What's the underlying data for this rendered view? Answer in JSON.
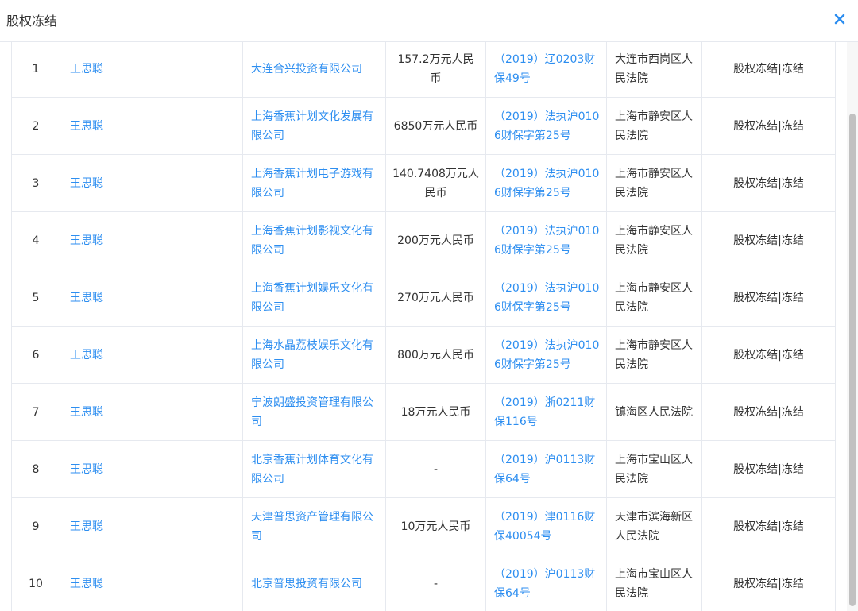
{
  "header": {
    "title": "股权冻结",
    "close_icon": "close-icon"
  },
  "colors": {
    "link": "#2d8ef0",
    "border": "#e6e9ef",
    "text": "#333333"
  },
  "rows": [
    {
      "index": "1",
      "person": "王思聪",
      "company": "大连合兴投资有限公司",
      "amount": "157.2万元人民币",
      "case_no": "（2019）辽0203财保49号",
      "court": "大连市西岗区人民法院",
      "status": "股权冻结|冻结"
    },
    {
      "index": "2",
      "person": "王思聪",
      "company": "上海香蕉计划文化发展有限公司",
      "amount": "6850万元人民币",
      "case_no": "（2019）法执沪0106财保字第25号",
      "court": "上海市静安区人民法院",
      "status": "股权冻结|冻结"
    },
    {
      "index": "3",
      "person": "王思聪",
      "company": "上海香蕉计划电子游戏有限公司",
      "amount": "140.7408万元人民币",
      "case_no": "（2019）法执沪0106财保字第25号",
      "court": "上海市静安区人民法院",
      "status": "股权冻结|冻结"
    },
    {
      "index": "4",
      "person": "王思聪",
      "company": "上海香蕉计划影视文化有限公司",
      "amount": "200万元人民币",
      "case_no": "（2019）法执沪0106财保字第25号",
      "court": "上海市静安区人民法院",
      "status": "股权冻结|冻结"
    },
    {
      "index": "5",
      "person": "王思聪",
      "company": "上海香蕉计划娱乐文化有限公司",
      "amount": "270万元人民币",
      "case_no": "（2019）法执沪0106财保字第25号",
      "court": "上海市静安区人民法院",
      "status": "股权冻结|冻结"
    },
    {
      "index": "6",
      "person": "王思聪",
      "company": "上海水晶荔枝娱乐文化有限公司",
      "amount": "800万元人民币",
      "case_no": "（2019）法执沪0106财保字第25号",
      "court": "上海市静安区人民法院",
      "status": "股权冻结|冻结"
    },
    {
      "index": "7",
      "person": "王思聪",
      "company": "宁波朗盛投资管理有限公司",
      "amount": "18万元人民币",
      "case_no": "（2019）浙0211财保116号",
      "court": "镇海区人民法院",
      "status": "股权冻结|冻结"
    },
    {
      "index": "8",
      "person": "王思聪",
      "company": "北京香蕉计划体育文化有限公司",
      "amount": "-",
      "case_no": "（2019）沪0113财保64号",
      "court": "上海市宝山区人民法院",
      "status": "股权冻结|冻结"
    },
    {
      "index": "9",
      "person": "王思聪",
      "company": "天津普思资产管理有限公司",
      "amount": "10万元人民币",
      "case_no": "（2019）津0116财保40054号",
      "court": "天津市滨海新区人民法院",
      "status": "股权冻结|冻结"
    },
    {
      "index": "10",
      "person": "王思聪",
      "company": "北京普思投资有限公司",
      "amount": "-",
      "case_no": "（2019）沪0113财保64号",
      "court": "上海市宝山区人民法院",
      "status": "股权冻结|冻结"
    }
  ]
}
